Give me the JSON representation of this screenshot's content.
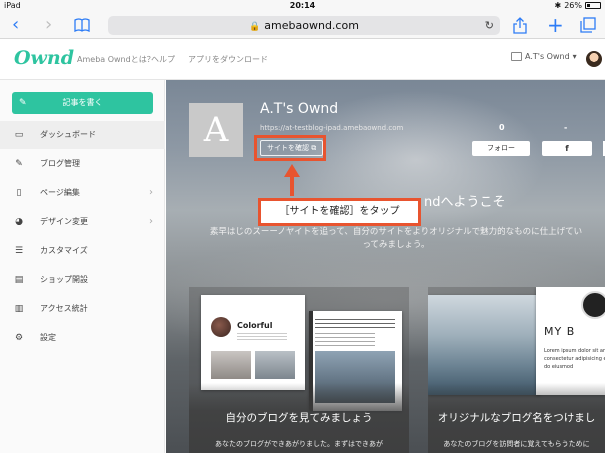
{
  "status_bar": {
    "device": "iPad",
    "time": "20:14",
    "battery": "26%"
  },
  "browser": {
    "url": "amebaownd.com",
    "reload_icon": "reload-icon"
  },
  "header": {
    "logo": "Ownd",
    "links": [
      "Ameba Owndとは？",
      "ヘルプ",
      "アプリをダウンロード"
    ],
    "user": "A.T's Ownd"
  },
  "sidebar": {
    "write_button": "記事を書く",
    "items": [
      {
        "label": "ダッシュボード",
        "icon": "dashboard-icon",
        "active": true
      },
      {
        "label": "ブログ管理",
        "icon": "edit-icon"
      },
      {
        "label": "ページ編集",
        "icon": "page-icon",
        "chevron": true
      },
      {
        "label": "デザイン変更",
        "icon": "palette-icon",
        "chevron": true
      },
      {
        "label": "カスタマイズ",
        "icon": "sliders-icon"
      },
      {
        "label": "ショップ開設",
        "icon": "shop-icon"
      },
      {
        "label": "アクセス統計",
        "icon": "stats-icon"
      },
      {
        "label": "設定",
        "icon": "gear-icon"
      }
    ]
  },
  "hero": {
    "avatar_letter": "A",
    "title": "A.T's Ownd",
    "url": "https://at-testblog-ipad.amebaownd.com",
    "view_site_button": "サイトを確認",
    "followers": "0",
    "follower_second": "-",
    "follow_button": "フォロー",
    "facebook_button": "f",
    "welcome_title": "ndへようこそ",
    "welcome_text": "素早はじのスーーノヤイトを追って、自分のサイトをよりオリジナルで魅力的なものに仕上げていってみましょう。"
  },
  "annotation": {
    "callout": "［サイトを確認］をタップ"
  },
  "cards": [
    {
      "title": "自分のブログを見てみましょう",
      "subtitle": "あなたのブログができあがりました。まずはできあが",
      "mock_blog_name": "Colorful"
    },
    {
      "title": "オリジナルなブログ名をつけまし",
      "subtitle": "あなたのブログを訪問者に覚えてもらうために",
      "mock_big_text": "MY B",
      "mock_text": "Lorem ipsum dolor sit amet, consectetur adipisicing elit, sed do eiusmod"
    }
  ]
}
